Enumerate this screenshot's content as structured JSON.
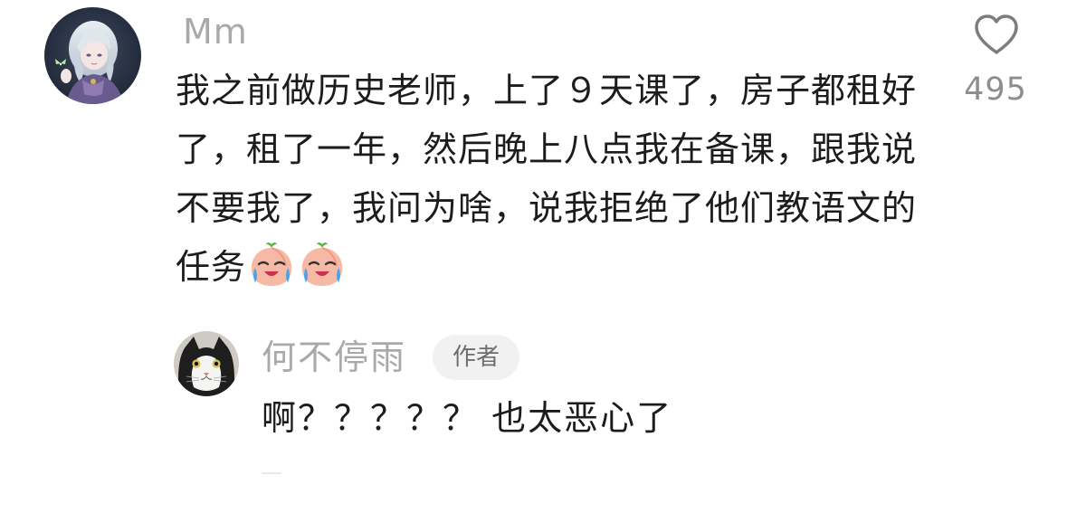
{
  "comment": {
    "username": "Mm",
    "avatar_icon": "anime-girl-avatar",
    "text": "我之前做历史老师，上了９天课了，房子都租好了，租了一年，然后晚上八点我在备课，跟我说不要我了，我问为啥，说我拒绝了他们教语文的任务",
    "emojis": [
      "crying-peach-emoji",
      "crying-peach-emoji"
    ]
  },
  "like": {
    "icon": "heart-outline-icon",
    "count": "495"
  },
  "reply": {
    "username": "何不停雨",
    "avatar_icon": "cat-avatar",
    "badge": "作者",
    "text": "啊？？？？？ 也太恶心了"
  },
  "colors": {
    "username": "#a9a9a9",
    "text": "#1c1c1c",
    "like_count": "#8d8d8d",
    "badge_bg": "#f1f1f1",
    "badge_text": "#6e6e6e"
  }
}
